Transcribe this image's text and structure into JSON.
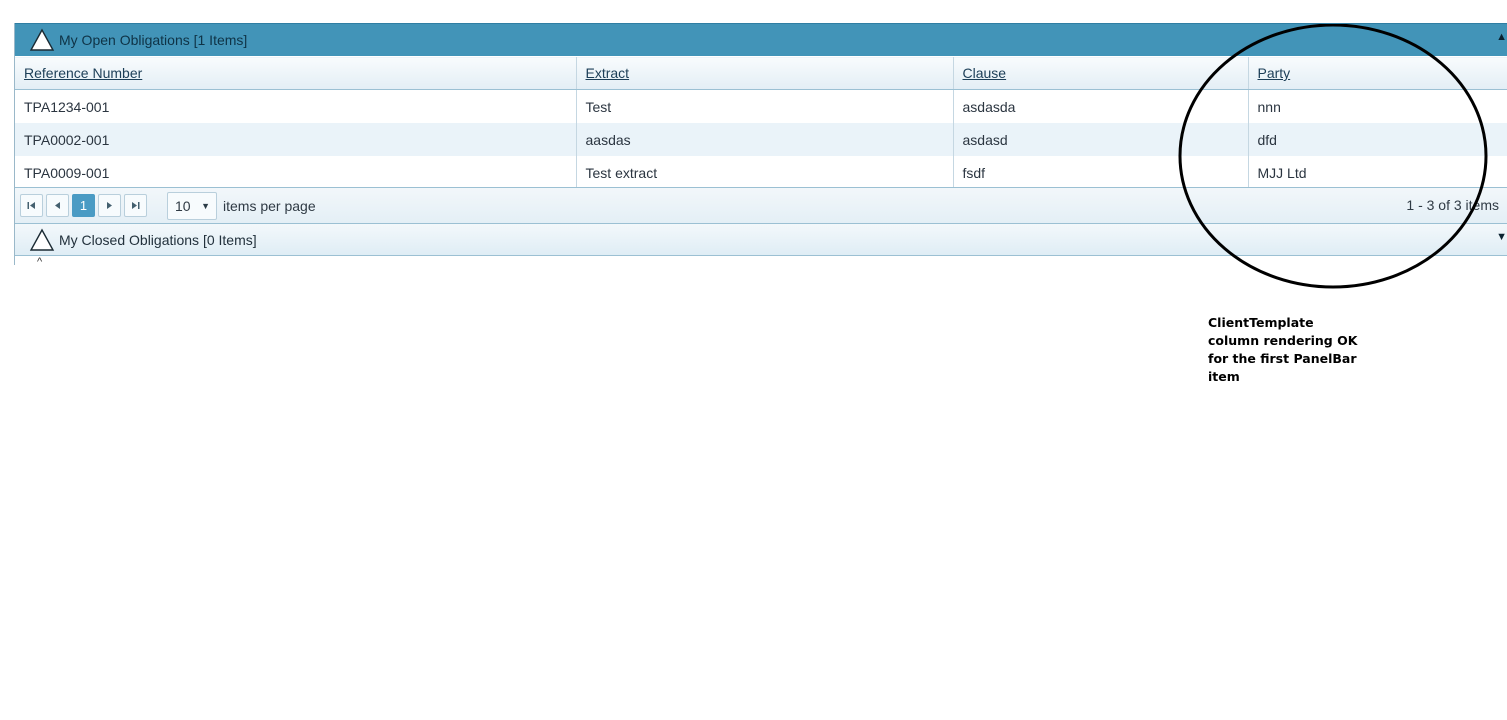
{
  "open_panel": {
    "title": "My Open Obligations [1 Items]",
    "collapse_arrow": "▲",
    "icon": "triangle-outline-icon"
  },
  "closed_panel": {
    "title": "My Closed Obligations [0 Items]",
    "expand_arrow": "▼",
    "icon": "triangle-outline-icon"
  },
  "grid": {
    "columns": [
      "Reference Number",
      "Extract",
      "Clause",
      "Party"
    ],
    "rows": [
      [
        "TPA1234-001",
        "Test",
        "asdasda",
        "nnn"
      ],
      [
        "TPA0002-001",
        "aasdas",
        "asdasd",
        "dfd"
      ],
      [
        "TPA0009-001",
        "Test extract",
        "fsdf",
        "MJJ Ltd"
      ]
    ]
  },
  "pager": {
    "current_page": "1",
    "page_size": "10",
    "items_per_page_label": "items per page",
    "info": "1 - 3 of 3 items"
  },
  "stray_caret": "^",
  "annotation": {
    "line1": "ClientTemplate",
    "line2": "column rendering OK",
    "line3": "for the first PanelBar",
    "line4": "item"
  },
  "colors": {
    "header_active": "#4294b8",
    "pager_current": "#4a9bc4"
  }
}
